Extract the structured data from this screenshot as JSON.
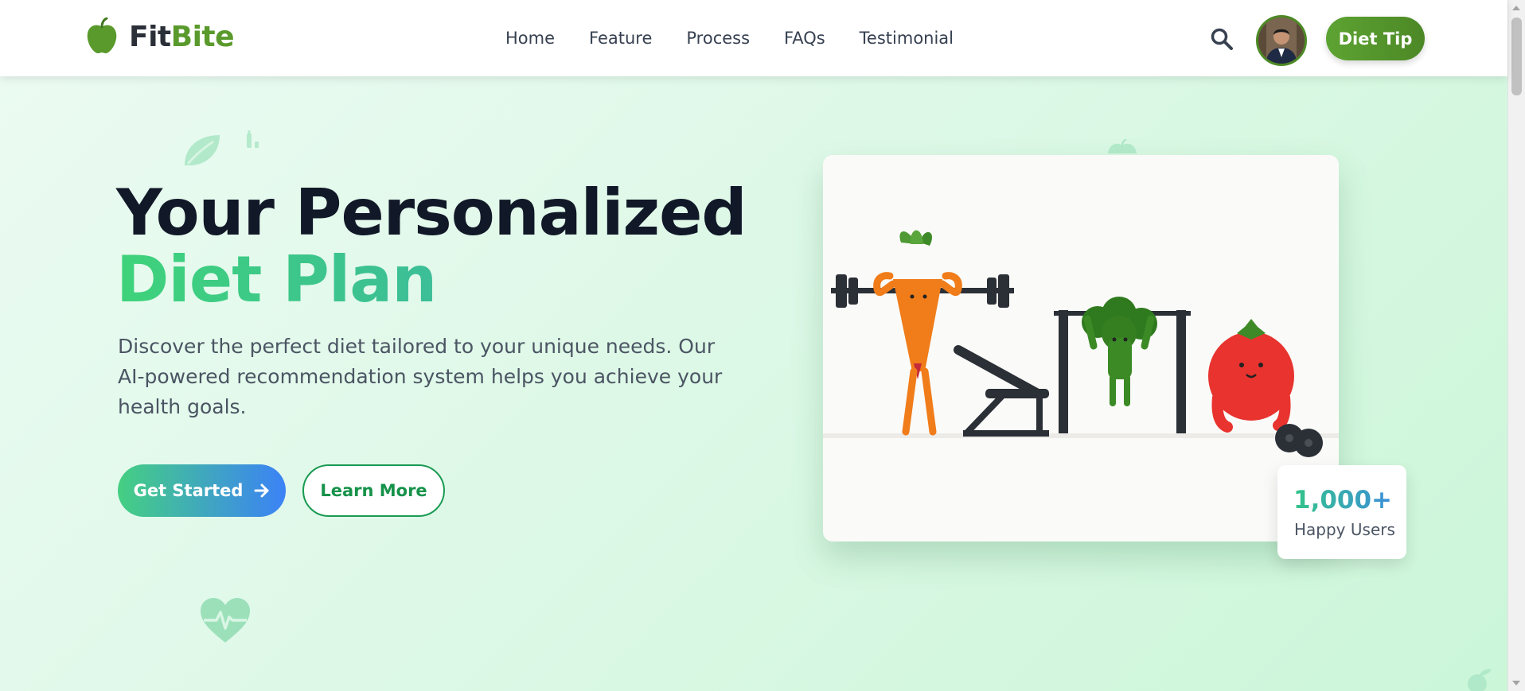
{
  "header": {
    "logo_fit": "Fit",
    "logo_bite": "Bite",
    "nav": [
      {
        "label": "Home"
      },
      {
        "label": "Feature"
      },
      {
        "label": "Process"
      },
      {
        "label": "FAQs"
      },
      {
        "label": "Testimonial"
      }
    ],
    "search_icon": "search-icon",
    "diet_tip_label": "Diet Tip"
  },
  "hero": {
    "title_line1": "Your Personalized",
    "title_line2": "Diet Plan",
    "description": "Discover the perfect diet tailored to your unique needs. Our AI-powered recommendation system helps you achieve your health goals.",
    "get_started_label": "Get Started",
    "learn_more_label": "Learn More"
  },
  "stat": {
    "value": "1,000+",
    "label": "Happy Users"
  },
  "colors": {
    "brand_green": "#5a9a2c",
    "gradient_start": "#45cf82",
    "gradient_end": "#3b82f6"
  }
}
